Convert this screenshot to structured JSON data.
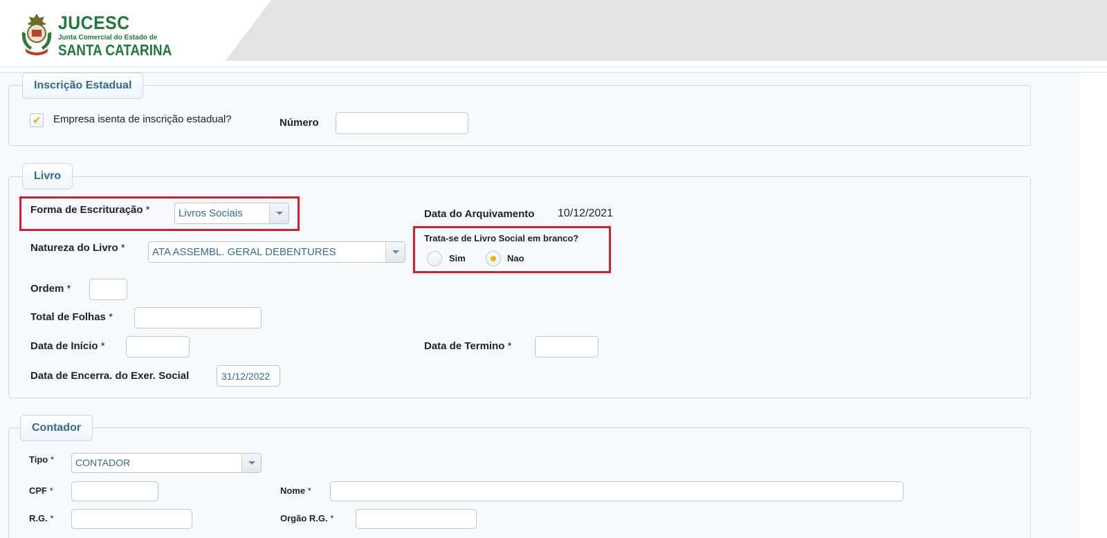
{
  "header": {
    "brand_title": "JUCESC",
    "brand_subtitle": "Junta Comercial do Estado de",
    "brand_state": "SANTA CATARINA"
  },
  "inscricao": {
    "legend": "Inscrição Estadual",
    "exempt_label": "Empresa isenta de inscrição estadual?",
    "exempt_checked": true,
    "numero_label": "Número",
    "numero_value": ""
  },
  "livro": {
    "legend": "Livro",
    "forma_label": "Forma de Escrituração",
    "forma_value": "Livros Sociais",
    "required_mark": "*",
    "arquivamento_label": "Data do Arquivamento",
    "arquivamento_value": "10/12/2021",
    "natureza_label": "Natureza do Livro",
    "natureza_value": "ATA ASSEMBL. GERAL DEBENTURES",
    "branco_question": "Trata-se de Livro Social em branco?",
    "branco_options": [
      "Sim",
      "Nao"
    ],
    "branco_selected": "Nao",
    "ordem_label": "Ordem",
    "total_folhas_label": "Total de Folhas",
    "data_inicio_label": "Data de Início",
    "data_termino_label": "Data de Termino",
    "encerra_label": "Data de Encerra. do Exer. Social",
    "encerra_value": "31/12/2022"
  },
  "contador": {
    "legend": "Contador",
    "tipo_label": "Tipo",
    "tipo_value": "CONTADOR",
    "cpf_label": "CPF",
    "nome_label": "Nome",
    "rg_label": "R.G.",
    "orgao_rg_label": "Orgão R.G."
  },
  "colors": {
    "accent": "#2f6c95",
    "highlight": "#d0202a",
    "brand_green": "#1e7a3a",
    "check_yellow": "#f0b400"
  }
}
